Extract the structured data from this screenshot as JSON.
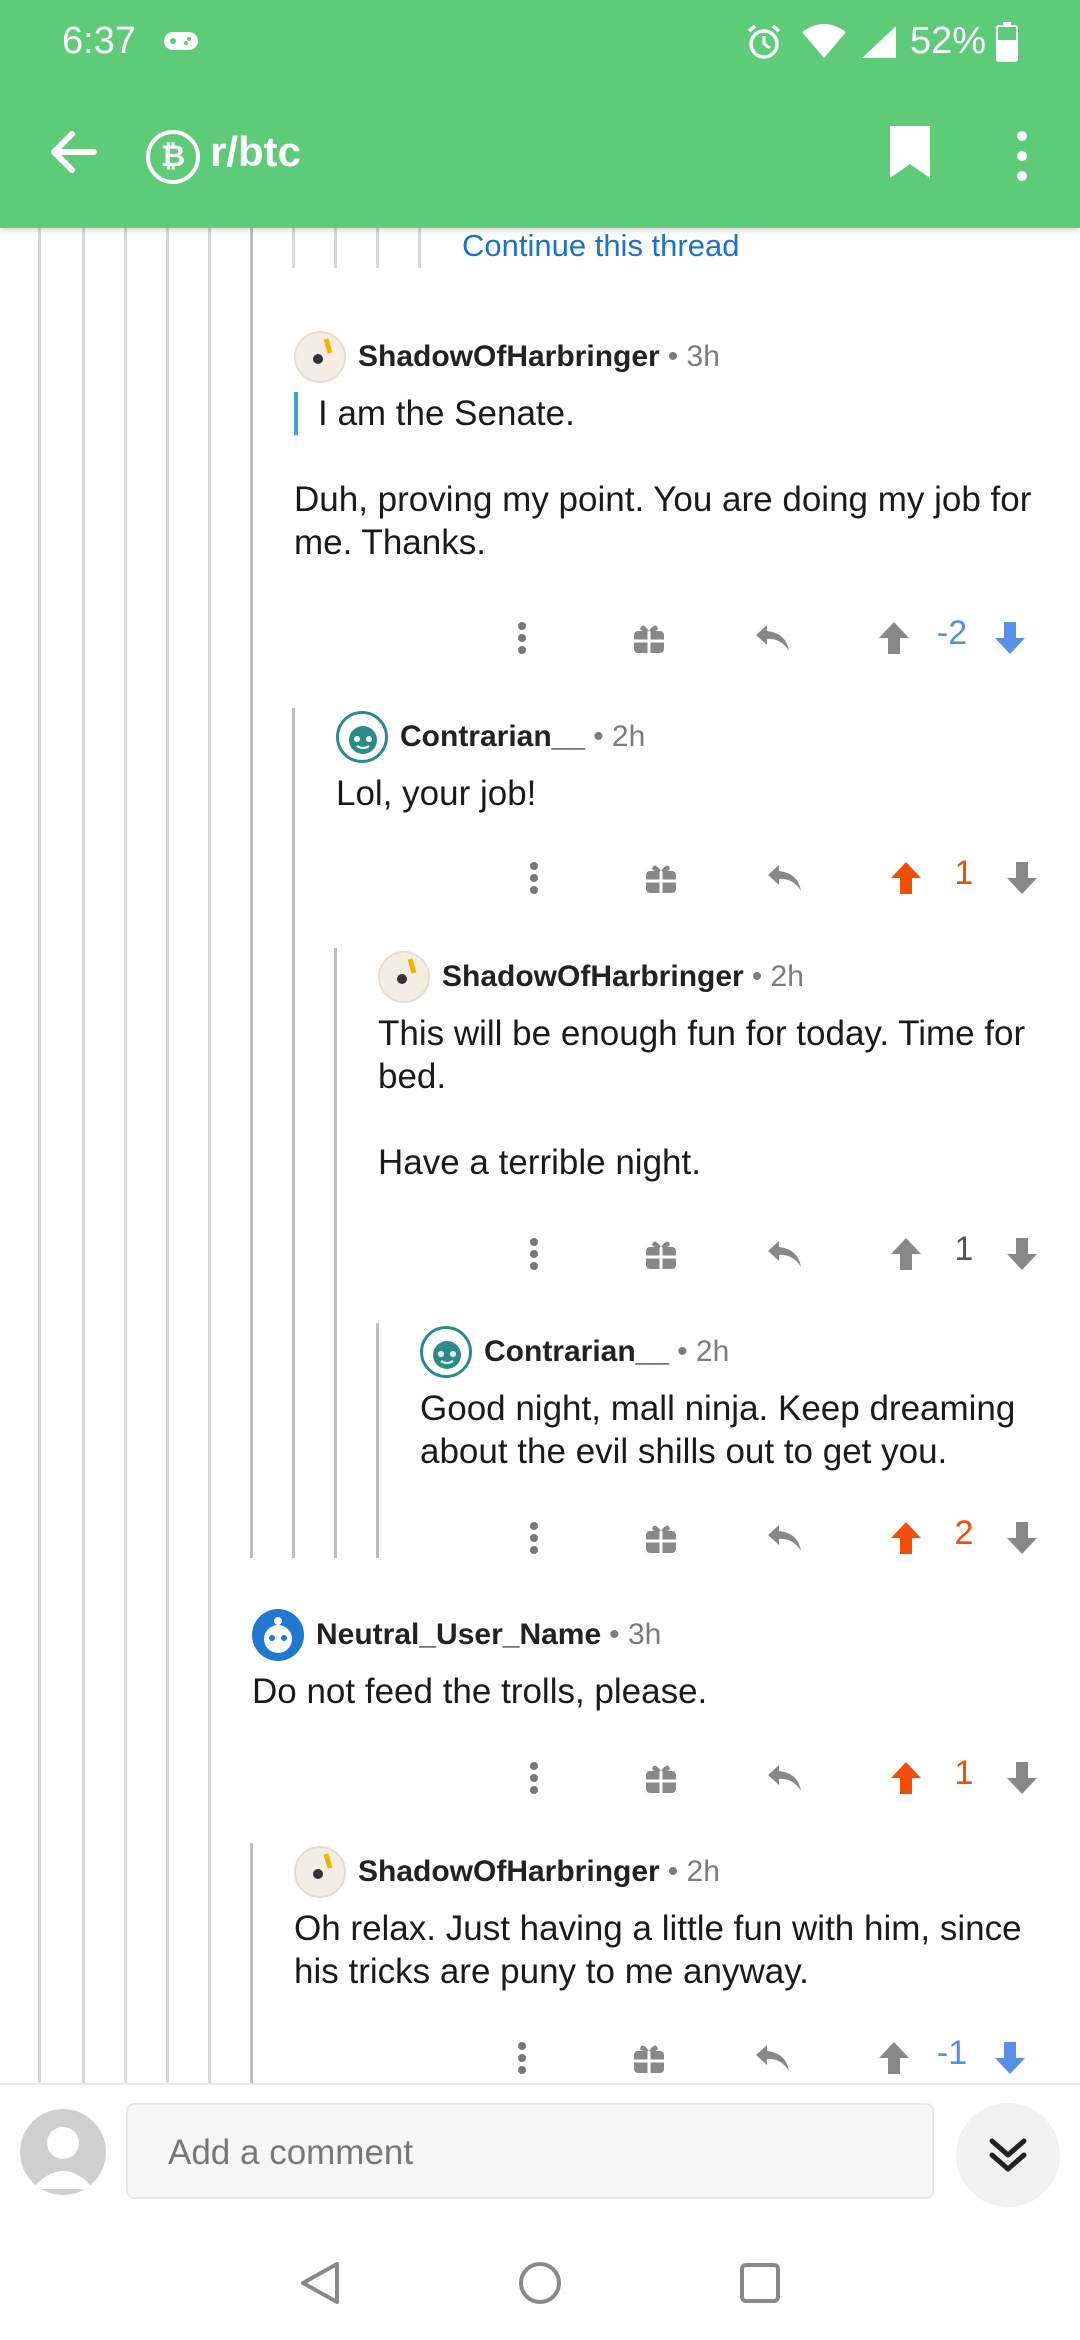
{
  "status": {
    "time": "6:37",
    "battery": "52%"
  },
  "header": {
    "subreddit": "r/btc",
    "subreddit_icon": "bitcoin-icon",
    "accent": "#5ecb79"
  },
  "thread": {
    "continue_label": "Continue this thread",
    "comments": [
      {
        "user": "ShadowOfHarbringer",
        "time": "3h",
        "quote": "I am the Senate.",
        "body": [
          "Duh, proving my point. You are doing my job for me. Thanks."
        ],
        "score": "-2",
        "vote": "down"
      },
      {
        "user": "Contrarian__",
        "time": "2h",
        "body": [
          "Lol, your job!"
        ],
        "score": "1",
        "vote": "up"
      },
      {
        "user": "ShadowOfHarbringer",
        "time": "2h",
        "body": [
          "This will be enough fun for today. Time for bed.",
          "Have a terrible night."
        ],
        "score": "1",
        "vote": "none"
      },
      {
        "user": "Contrarian__",
        "time": "2h",
        "body": [
          "Good night, mall ninja. Keep dreaming about the evil shills out to get you."
        ],
        "score": "2",
        "vote": "up"
      },
      {
        "user": "Neutral_User_Name",
        "time": "3h",
        "body": [
          "Do not feed the trolls, please."
        ],
        "score": "1",
        "vote": "up"
      },
      {
        "user": "ShadowOfHarbringer",
        "time": "2h",
        "body": [
          "Oh relax. Just having a little fun with him, since his tricks are puny to me anyway."
        ],
        "score": "-1",
        "vote": "down"
      }
    ]
  },
  "composer": {
    "placeholder": "Add a comment"
  },
  "colors": {
    "upvote": "#f24e0a",
    "downvote": "#5a8ee8",
    "link": "#1a73c8"
  }
}
